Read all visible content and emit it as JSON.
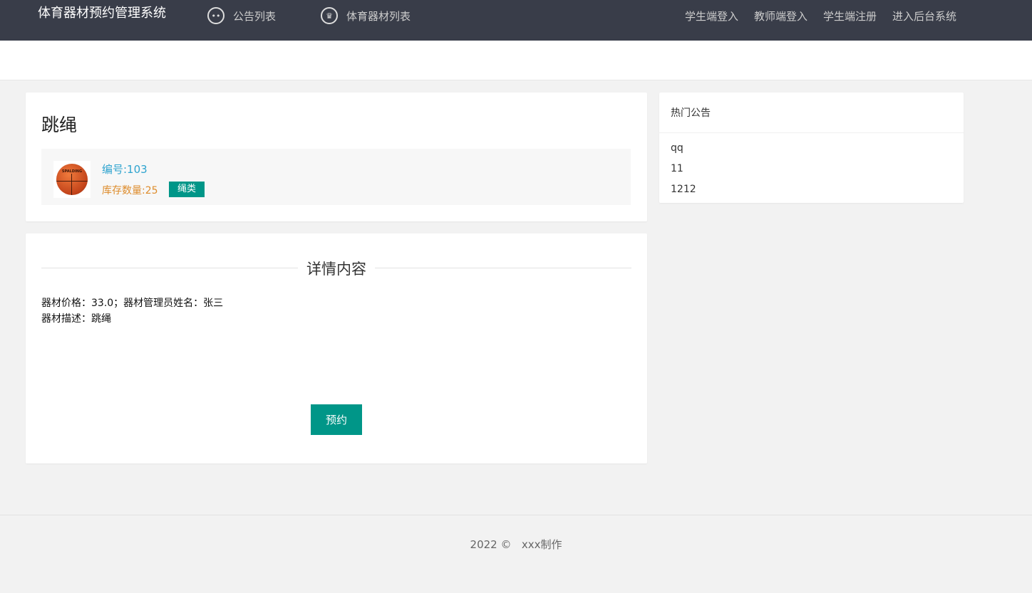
{
  "header": {
    "title": "体育器材预约管理系统",
    "nav": [
      {
        "label": "公告列表",
        "icon": "chat-icon"
      },
      {
        "label": "体育器材列表",
        "icon": "crown-icon"
      }
    ],
    "right_links": [
      "学生端登入",
      "教师端登入",
      "学生端注册",
      "进入后台系统"
    ]
  },
  "item": {
    "name": "跳绳",
    "code": "编号:103",
    "stock": "库存数量:25",
    "category": "绳类",
    "image_logo_text": "SPALDING"
  },
  "detail": {
    "heading": "详情内容",
    "line1": "器材价格：33.0；器材管理员姓名：张三",
    "line2": "器材描述：跳绳",
    "reserve_label": "预约"
  },
  "sidebar": {
    "title": "热门公告",
    "items": [
      "qq",
      "11",
      "1212"
    ]
  },
  "footer": {
    "year": "2022 ©",
    "author": "xxx制作"
  }
}
